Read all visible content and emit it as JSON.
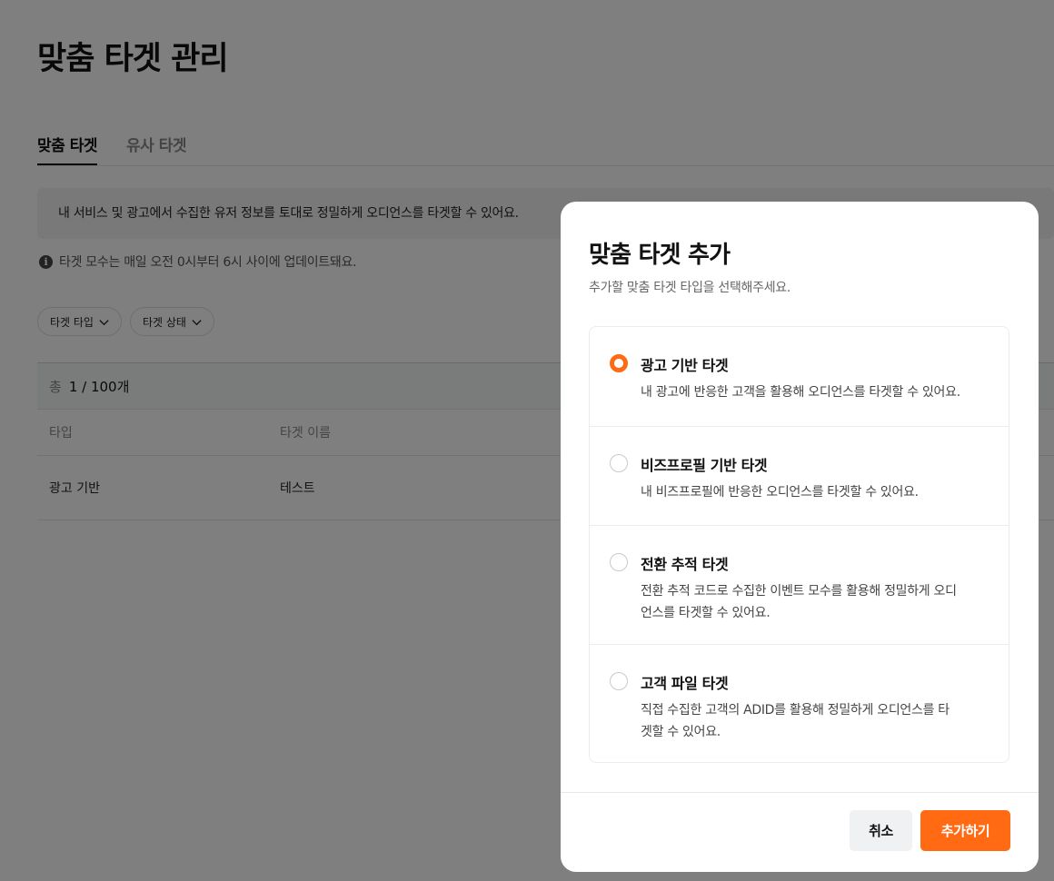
{
  "page": {
    "title": "맞춤 타겟 관리",
    "tabs": [
      {
        "label": "맞춤 타겟",
        "active": true
      },
      {
        "label": "유사 타겟",
        "active": false
      }
    ],
    "info_banner": "내 서비스 및 광고에서 수집한 유저 정보를 토대로 정밀하게 오디언스를 타겟할 수 있어요.",
    "notice": "타겟 모수는 매일 오전 0시부터 6시 사이에 업데이트돼요.",
    "notice_icon": "info-icon",
    "filters": [
      {
        "label": "타겟 타입",
        "icon": "chevron-down-icon"
      },
      {
        "label": "타겟 상태",
        "icon": "chevron-down-icon"
      }
    ],
    "table": {
      "total_label": "총",
      "total_count": "1 / 100개",
      "headers": [
        "타입",
        "타겟 이름"
      ],
      "rows": [
        [
          "광고 기반",
          "테스트"
        ]
      ]
    }
  },
  "modal": {
    "title": "맞춤 타겟 추가",
    "subtitle": "추가할 맞춤 타겟 타입을 선택해주세요.",
    "selected_index": 0,
    "options": [
      {
        "title": "광고 기반 타겟",
        "description": "내 광고에 반응한 고객을 활용해 오디언스를 타겟할 수 있어요."
      },
      {
        "title": "비즈프로필 기반 타겟",
        "description": "내 비즈프로필에 반응한 오디언스를 타겟할 수 있어요."
      },
      {
        "title": "전환 추적 타겟",
        "description": "전환 추적 코드로 수집한 이벤트 모수를 활용해 정밀하게 오디언스를 타겟할 수 있어요."
      },
      {
        "title": "고객 파일 타겟",
        "description": "직접 수집한 고객의 ADID를 활용해 정밀하게 오디언스를 타겟할 수 있어요."
      }
    ],
    "cancel_label": "취소",
    "submit_label": "추가하기"
  },
  "colors": {
    "accent": "#ff6a13",
    "overlay": "rgba(0,0,0,0.5)",
    "info_bg": "#f2f3f5"
  }
}
